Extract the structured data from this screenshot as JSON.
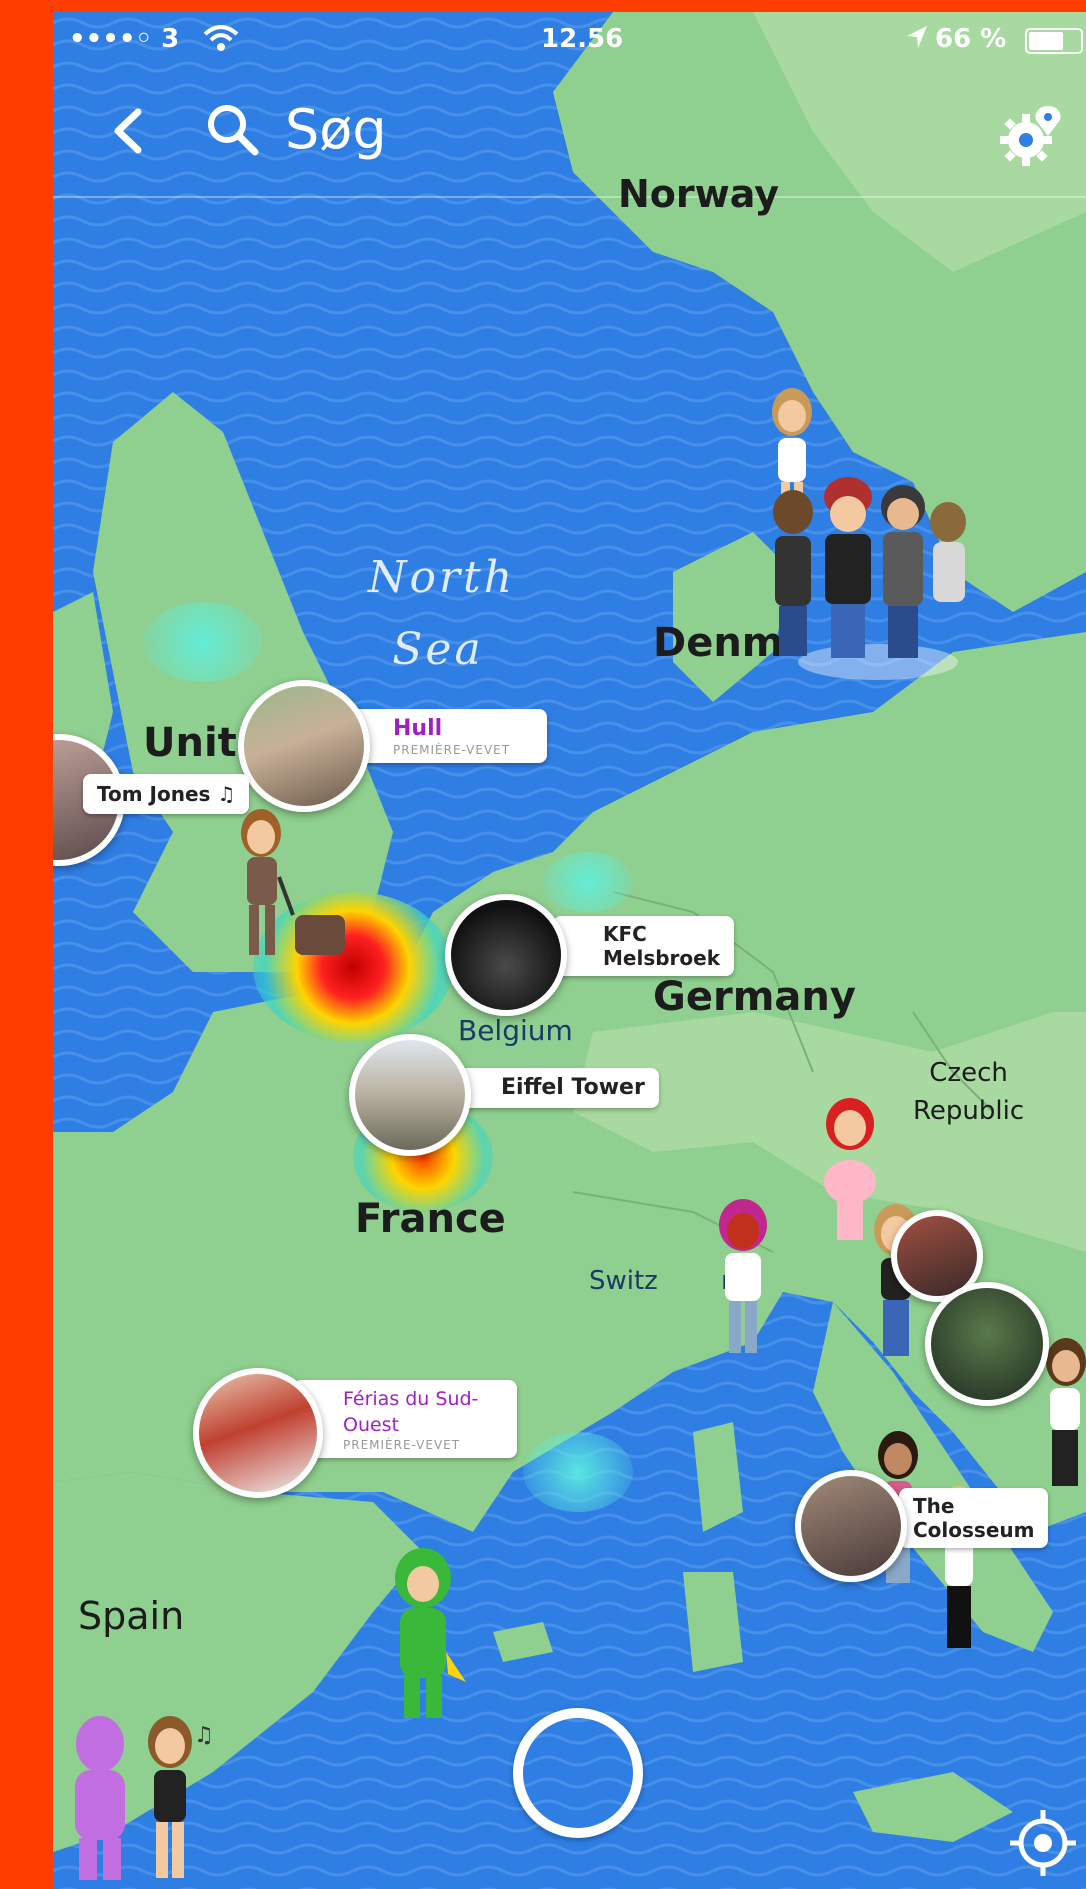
{
  "status": {
    "carrier": "••••◦ 3",
    "time": "12.56",
    "battery": "66 %"
  },
  "header": {
    "back_icon": "chevron-left-icon",
    "search_label": "Søg",
    "settings_icon": "gear-location-icon"
  },
  "map": {
    "countries": {
      "norway": "Norway",
      "denmark": "Denm",
      "united_kingdom": "Unit",
      "germany": "Germany",
      "belgium": "Belgium",
      "czech_line1": "Czech",
      "czech_line2": "Republic",
      "france": "France",
      "switzerland_a": "Switz",
      "switzerland_b": "nd",
      "spain": "Spain"
    },
    "sea": {
      "line1": "North",
      "line2": "Sea"
    },
    "places": [
      {
        "title": "Hull",
        "subtitle": "PREMIÈRE-VEVET"
      },
      {
        "title": "Tom Jones ♫"
      },
      {
        "title_line1": "KFC",
        "title_line2": "Melsbroek"
      },
      {
        "title": "Eiffel Tower"
      },
      {
        "title_line1": "Férias du Sud-",
        "title_line2": "Ouest",
        "subtitle": "PREMIÈRE-VEVET"
      },
      {
        "title_line1": "The",
        "title_line2": "Colosseum"
      }
    ]
  },
  "colors": {
    "frame": "#ff3d00",
    "water": "#2f7ee3",
    "land": "#8fcf8f",
    "accent_purple": "#a020c8"
  }
}
